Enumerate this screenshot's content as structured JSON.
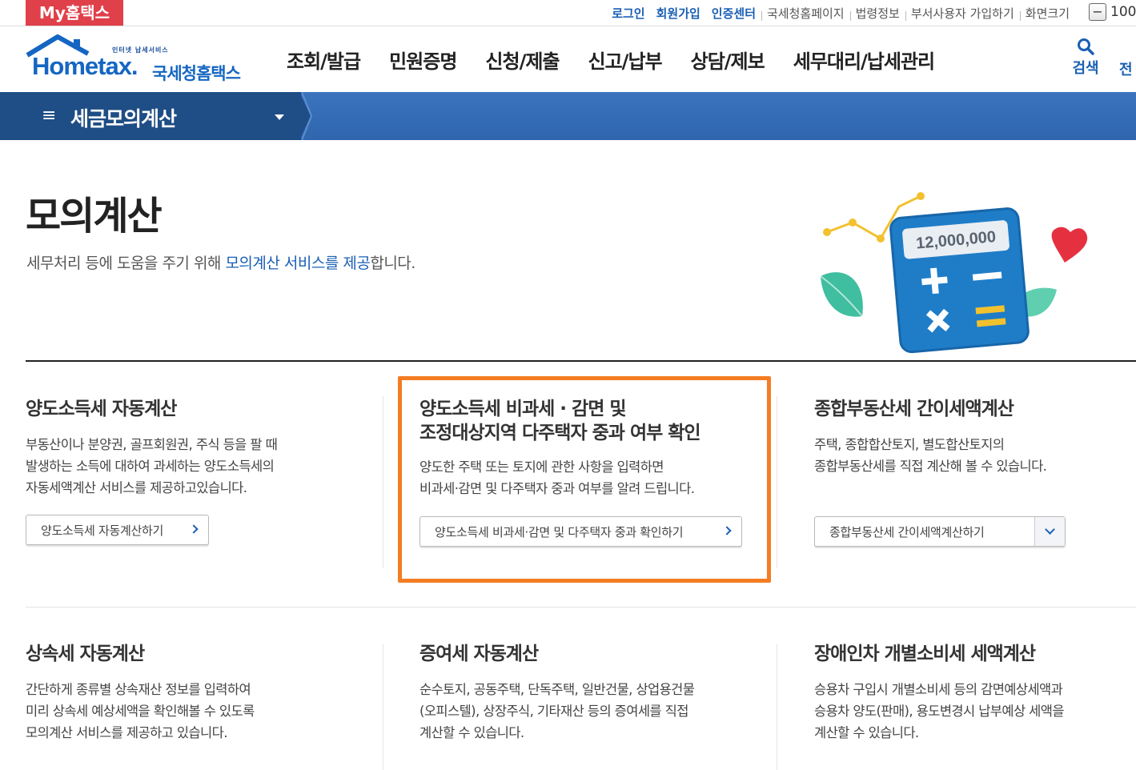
{
  "topbar": {
    "brand": "My홈택스",
    "links": [
      {
        "label": "로그인",
        "style": "blue"
      },
      {
        "label": "회원가입",
        "style": "blue"
      },
      {
        "label": "인증센터",
        "style": "blue"
      },
      {
        "label": "국세청홈페이지",
        "style": "gray"
      },
      {
        "label": "법령정보",
        "style": "gray"
      },
      {
        "label": "부서사용자 가입하기",
        "style": "gray"
      },
      {
        "label": "화면크기",
        "style": "gray"
      }
    ],
    "zoom_minus": "−",
    "zoom_value": "100"
  },
  "header": {
    "logo_sub": "인터넷 납세서비스",
    "logo_main": "Hometax.",
    "logo_kr": "국세청홈택스",
    "nav": [
      "조회/발급",
      "민원증명",
      "신청/제출",
      "신고/납부",
      "상담/제보",
      "세무대리/납세관리"
    ],
    "search_label": "검색",
    "more_label": "전"
  },
  "band": {
    "menu_icon": "≡",
    "title": "세금모의계산"
  },
  "intro": {
    "title": "모의계산",
    "desc_before": "세무처리 등에 도움을 주기 위해 ",
    "desc_highlight": "모의계산 서비스를 제공",
    "desc_after": "합니다.",
    "calc_display": "12,000,000"
  },
  "cards": [
    {
      "title": "양도소득세 자동계산",
      "desc": [
        "부동산이나 분양권, 골프회원권, 주식 등을 팔 때",
        "발생하는 소득에 대하여 과세하는 양도소득세의",
        "자동세액계산 서비스를 제공하고있습니다."
      ],
      "button": "양도소득세 자동계산하기"
    },
    {
      "title": [
        "양도소득세 비과세 · 감면 및",
        "조정대상지역 다주택자 중과 여부 확인"
      ],
      "desc": [
        "양도한 주택 또는 토지에 관한 사항을 입력하면",
        "비과세·감면 및 다주택자 중과 여부를 알려 드립니다."
      ],
      "button": "양도소득세 비과세·감면 및 다주택자 중과 확인하기"
    },
    {
      "title": "종합부동산세 간이세액계산",
      "desc": [
        "주택, 종합합산토지, 별도합산토지의",
        "종합부동산세를 직접 계산해 볼 수 있습니다."
      ],
      "button": "종합부동산세 간이세액계산하기"
    },
    {
      "title": "상속세 자동계산",
      "desc": [
        "간단하게 종류별 상속재산 정보를 입력하여",
        "미리 상속세 예상세액을 확인해볼 수 있도록",
        "모의계산 서비스를 제공하고 있습니다."
      ]
    },
    {
      "title": "증여세 자동계산",
      "desc": [
        "순수토지, 공동주택, 단독주택, 일반건물, 상업용건물",
        "(오피스텔), 상장주식, 기타재산 등의 증여세를 직접",
        "계산할 수 있습니다."
      ]
    },
    {
      "title": "장애인차 개별소비세 세액계산",
      "desc": [
        "승용차 구입시 개별소비세 등의 감면예상세액과",
        "승용차 양도(판매), 용도변경시 납부예상 세액을",
        "계산할 수 있습니다."
      ]
    }
  ],
  "colors": {
    "brand_red": "#e0404a",
    "brand_blue": "#1566c2",
    "band_blue": "#2f66ae",
    "band_dark": "#1f4d85",
    "highlight_orange": "#f47c22"
  }
}
